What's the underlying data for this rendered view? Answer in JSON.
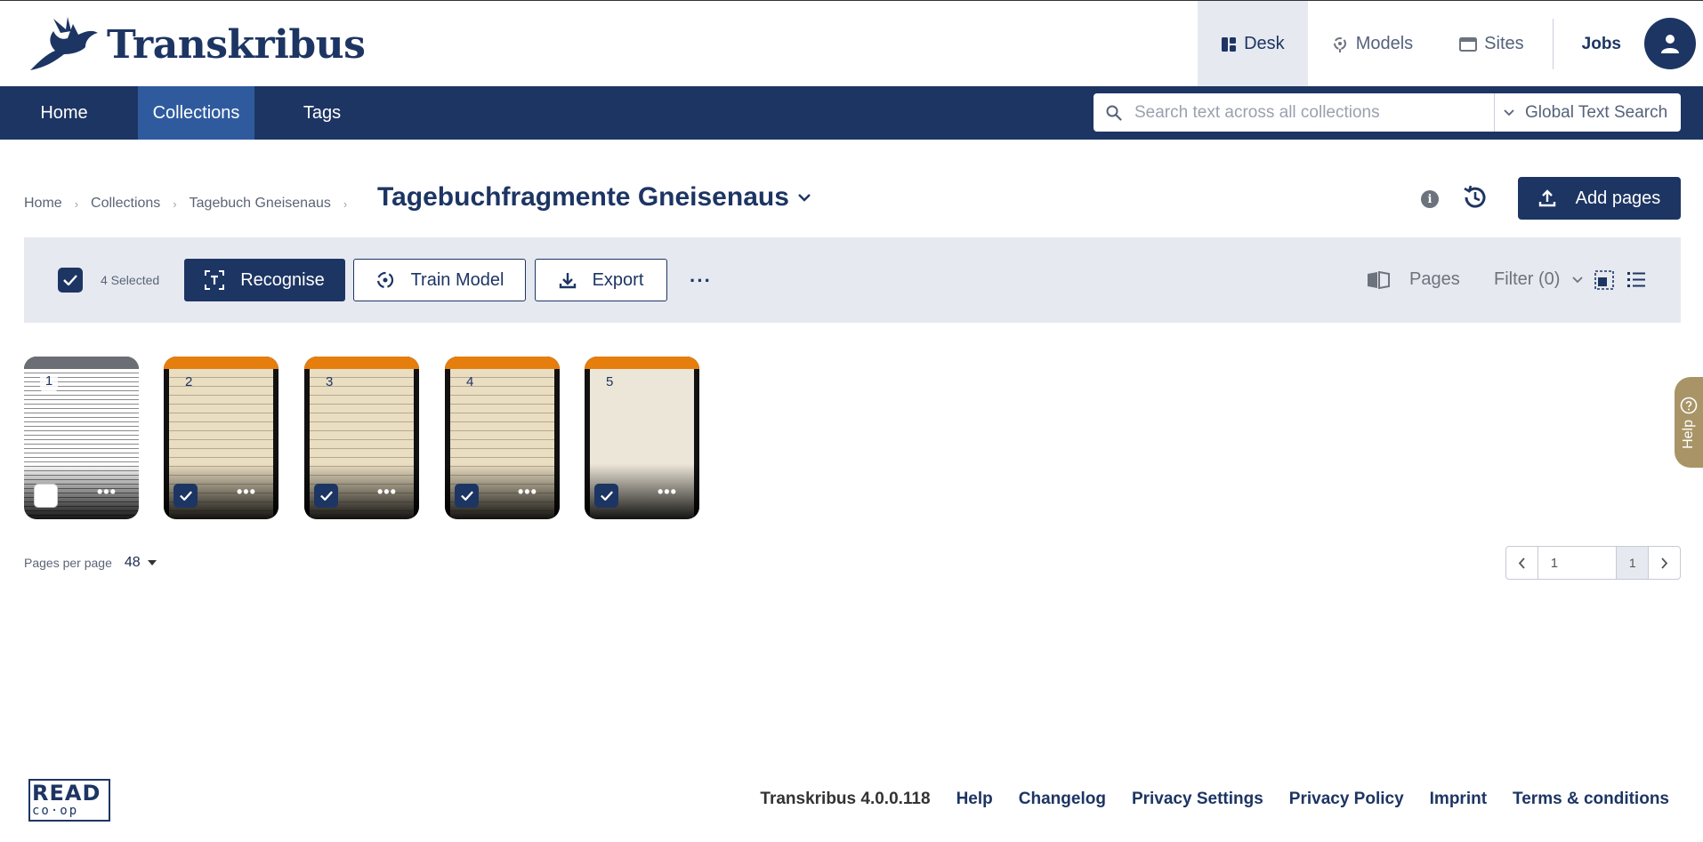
{
  "header": {
    "logo_text": "Transkribus",
    "nav": [
      {
        "label": "Desk",
        "icon": "desk-icon",
        "active": true
      },
      {
        "label": "Models",
        "icon": "models-icon",
        "active": false
      },
      {
        "label": "Sites",
        "icon": "sites-icon",
        "active": false
      }
    ],
    "jobs_label": "Jobs"
  },
  "navbar": {
    "tabs": [
      {
        "label": "Home",
        "active": false
      },
      {
        "label": "Collections",
        "active": true
      },
      {
        "label": "Tags",
        "active": false
      }
    ],
    "search_placeholder": "Search text across all collections",
    "search_scope": "Global Text Search"
  },
  "breadcrumb": [
    "Home",
    "Collections",
    "Tagebuch Gneisenaus"
  ],
  "page_title": "Tagebuchfragmente Gneisenaus",
  "add_pages_label": "Add pages",
  "toolbar": {
    "selected_text": "4 Selected",
    "recognise_label": "Recognise",
    "train_label": "Train Model",
    "export_label": "Export",
    "more_label": "···",
    "pages_label": "Pages",
    "filter_label": "Filter (0)"
  },
  "pages": [
    {
      "number": "1",
      "selected": false,
      "status_color": "#6b6e74"
    },
    {
      "number": "2",
      "selected": true,
      "status_color": "#e67e0e"
    },
    {
      "number": "3",
      "selected": true,
      "status_color": "#e67e0e"
    },
    {
      "number": "4",
      "selected": true,
      "status_color": "#e67e0e"
    },
    {
      "number": "5",
      "selected": true,
      "status_color": "#e67e0e"
    }
  ],
  "pagination": {
    "per_page_label": "Pages per page",
    "per_page_value": "48",
    "current_page": "1",
    "total_pages": "1"
  },
  "help_label": "Help",
  "footer": {
    "logo_line1": "READ",
    "logo_line2": "co·op",
    "version": "Transkribus 4.0.0.118",
    "links": [
      "Help",
      "Changelog",
      "Privacy Settings",
      "Privacy Policy",
      "Imprint",
      "Terms & conditions"
    ]
  },
  "colors": {
    "brand": "#1d3563",
    "accent_orange": "#e67e0e",
    "help_tab": "#a89466"
  }
}
